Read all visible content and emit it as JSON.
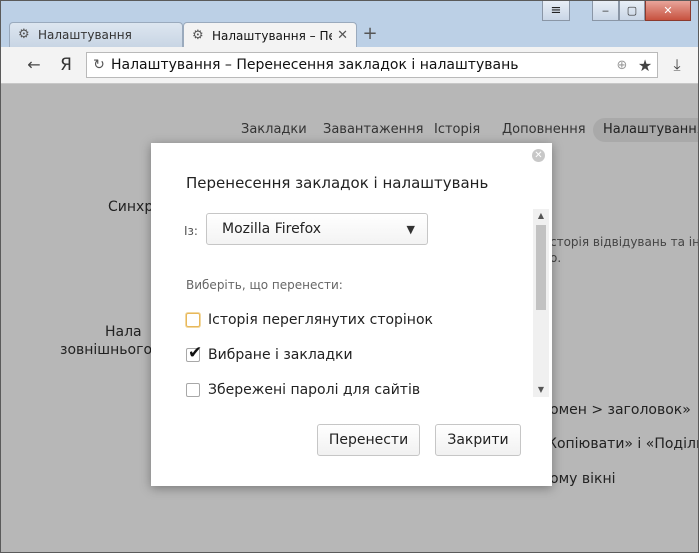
{
  "window": {
    "close_glyph": "✕",
    "max_glyph": "▢",
    "min_glyph": "‒",
    "menu_glyph": "≡"
  },
  "tabs": [
    {
      "label": "Налаштування",
      "active": false,
      "close": ""
    },
    {
      "label": "Налаштування – Перенесення",
      "active": true,
      "close": "✕"
    }
  ],
  "new_tab_glyph": "+",
  "toolbar": {
    "back_glyph": "←",
    "logo": "Я",
    "reload_glyph": "↻",
    "address": "Налаштування – Перенесення закладок і налаштувань",
    "download_glyph": "⤓",
    "star_glyph": "★"
  },
  "nav": {
    "items": [
      "Закладки",
      "Завантаження",
      "Історія",
      "Доповнення",
      "Налаштування"
    ],
    "active_index": 4
  },
  "background_text": {
    "sync_heading": "Синхро",
    "appearance_heading_1": "Нала",
    "appearance_heading_2": "зовнішнього",
    "history_text": "сторія відвідувань та інш",
    "history_text_2": "о.",
    "domain_text": "омен > заголовок»",
    "copy_text": "Копіювати» і «Поділи",
    "window_text": "ому вікні"
  },
  "dialog": {
    "title": "Перенесення закладок і налаштувань",
    "close_glyph": "✕",
    "from_label": "Із:",
    "source_value": "Mozilla Firefox",
    "choose_label": "Виберіть, що перенести:",
    "options": [
      {
        "label": "Історія переглянутих сторінок",
        "checked": false
      },
      {
        "label": "Вибране і закладки",
        "checked": true
      },
      {
        "label": "Збережені паролі для сайтів",
        "checked": false
      }
    ],
    "transfer_button": "Перенести",
    "close_button": "Закрити",
    "check_glyph": "✔"
  },
  "colors": {
    "overlay": "#b7b7b7",
    "modal": "#ffffff",
    "focus": "#e8b85a"
  }
}
